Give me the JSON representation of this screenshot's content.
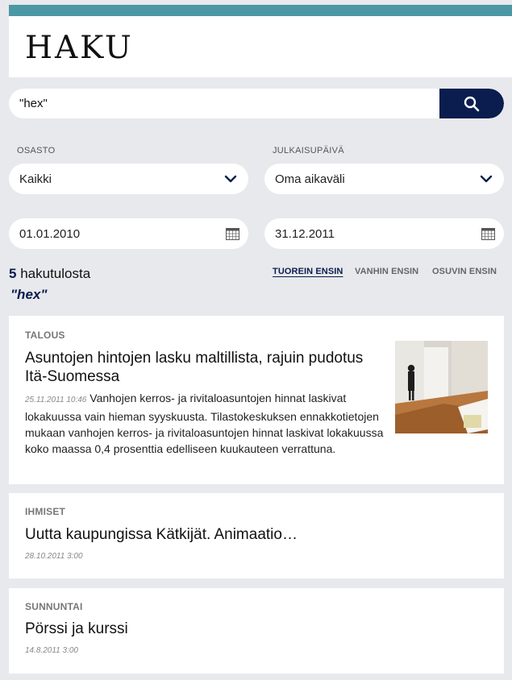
{
  "header": {
    "title": "HAKU"
  },
  "search": {
    "value": "\"hex\"",
    "button_icon": "search-icon"
  },
  "filters": {
    "section_label": "OSASTO",
    "section_value": "Kaikki",
    "date_label": "JULKAISUPÄIVÄ",
    "date_value": "Oma aikaväli",
    "date_from": "01.01.2010",
    "date_to": "31.12.2011"
  },
  "results": {
    "count": "5",
    "count_label": "hakutulosta",
    "query": "\"hex\"",
    "sort": [
      {
        "label": "TUOREIN ENSIN",
        "active": true
      },
      {
        "label": "VANHIN ENSIN",
        "active": false
      },
      {
        "label": "OSUVIN ENSIN",
        "active": false
      }
    ],
    "items": [
      {
        "category": "TALOUS",
        "title_line1": "Asuntojen hintojen lasku maltillista, rajuin pudotus",
        "title_line2": "Itä-Suomessa",
        "date": "25.11.2011 10:46",
        "excerpt": "Vanhojen kerros- ja rivitaloasuntojen hinnat laskivat lokakuussa vain hieman syyskuusta. Tilastokeskuksen ennakkotietojen mukaan vanhojen kerros- ja rivitaloasuntojen hinnat laskivat lokakuussa koko maassa 0,4 prosenttia edelliseen kuukauteen verrattuna."
      },
      {
        "category": "IHMISET",
        "title": "Uutta kaupungissa Kätkijät. Animaatio…",
        "date": "28.10.2011 3:00"
      },
      {
        "category": "SUNNUNTAI",
        "title": "Pörssi ja kurssi",
        "date": "14.8.2011 3:00"
      }
    ]
  },
  "colors": {
    "accent": "#4a98a3",
    "navy": "#0b1d4e",
    "background": "#e8e9ed"
  }
}
